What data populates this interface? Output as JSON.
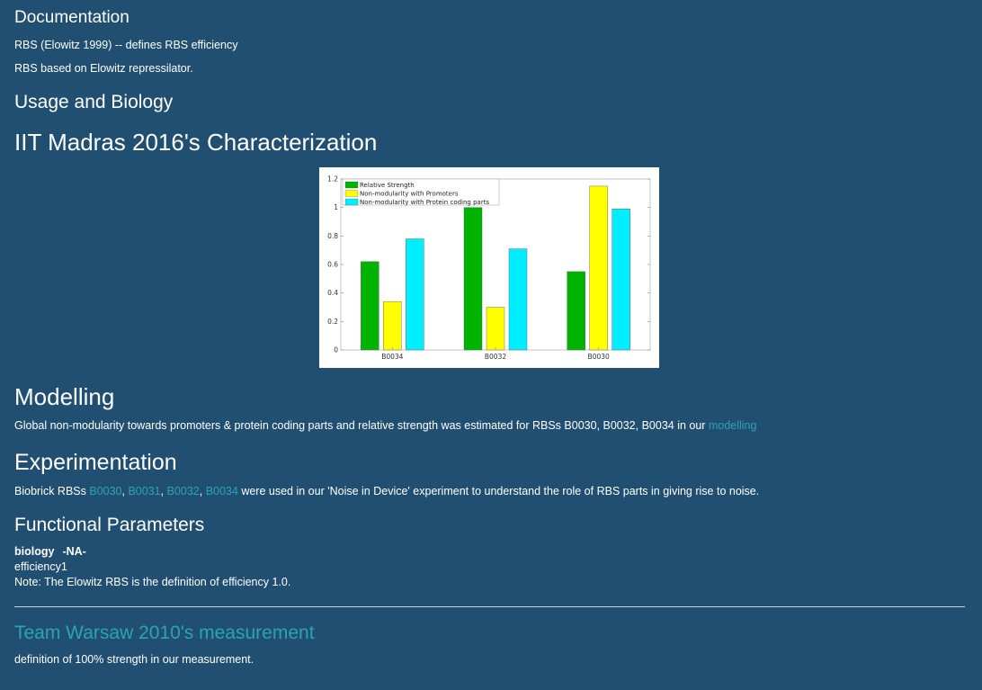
{
  "documentation": {
    "title": "Documentation",
    "line1": "RBS (Elowitz 1999) -- defines RBS efficiency",
    "line2": "RBS based on Elowitz repressilator."
  },
  "usage": {
    "title": "Usage and Biology"
  },
  "characterization": {
    "title": "IIT Madras 2016's Characterization"
  },
  "chart_data": {
    "type": "bar",
    "categories": [
      "B0034",
      "B0032",
      "B0030"
    ],
    "series": [
      {
        "name": "Relative Strength",
        "color": "#00b300",
        "values": [
          0.62,
          1.0,
          0.55
        ]
      },
      {
        "name": "Non-modularity with Promoters",
        "color": "#ffff00",
        "values": [
          0.34,
          0.3,
          1.15
        ]
      },
      {
        "name": "Non-modularity with Protein coding parts",
        "color": "#00eeff",
        "values": [
          0.78,
          0.71,
          0.99
        ]
      }
    ],
    "yticks": [
      "0",
      "0.2",
      "0.4",
      "0.6",
      "0.8",
      "1",
      "1.2"
    ],
    "ylim": [
      0,
      1.2
    ],
    "grid": false,
    "legend_position": "top-left"
  },
  "modelling": {
    "title": "Modelling",
    "text": "Global non-modularity towards promoters & protein coding parts and relative strength was estimated for RBSs B0030, B0032, B0034 in our ",
    "link": "modelling"
  },
  "experimentation": {
    "title": "Experimentation",
    "prefix": "Biobrick RBSs ",
    "links": [
      "B0030",
      "B0031",
      "B0032",
      "B0034"
    ],
    "sep": ", ",
    "suffix": " were used in our 'Noise in Device' experiment to understand the role of RBS parts in giving rise to noise."
  },
  "functional": {
    "title": "Functional Parameters",
    "biology_label": "biology",
    "biology_value": "-NA-",
    "efficiency": "efficiency1",
    "note": "Note: The Elowitz RBS is the definition of efficiency 1.0."
  },
  "warsaw": {
    "title": "Team Warsaw 2010's measurement",
    "text": "definition of 100% strength in our measurement."
  }
}
